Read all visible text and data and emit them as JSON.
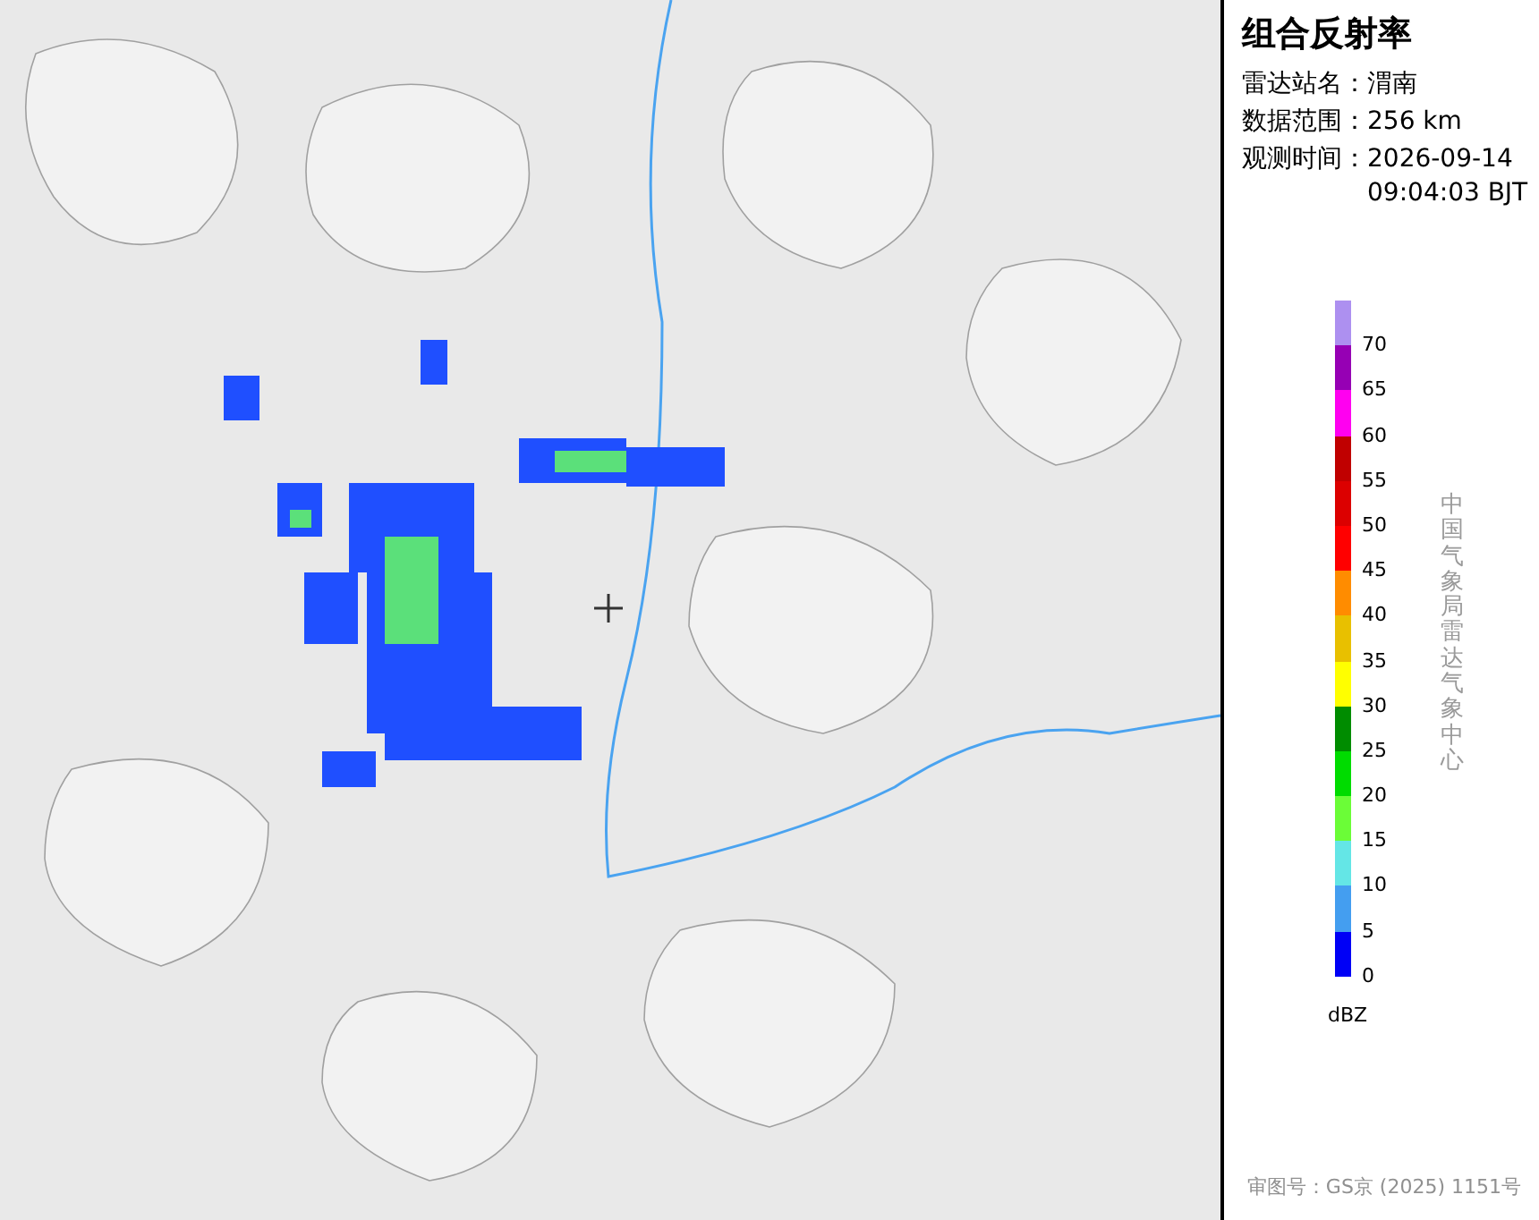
{
  "title": "组合反射率",
  "info": [
    {
      "label": "雷达站名：",
      "value": "渭南"
    },
    {
      "label": "数据范围：",
      "value": "256 km"
    },
    {
      "label": "观测时间：",
      "value": "2026-09-14 09:04:03 BJT"
    }
  ],
  "legend": {
    "items": [
      {
        "label": "70",
        "color": "#ad90f0"
      },
      {
        "label": "65",
        "color": "#9600b4"
      },
      {
        "label": "60",
        "color": "#ff00f0"
      },
      {
        "label": "55",
        "color": "#c00000"
      },
      {
        "label": "50",
        "color": "#dc0000"
      },
      {
        "label": "45",
        "color": "#ff0000"
      },
      {
        "label": "40",
        "color": "#ff8c00"
      },
      {
        "label": "35",
        "color": "#e8c000"
      },
      {
        "label": "30",
        "color": "#ffff00"
      },
      {
        "label": "25",
        "color": "#008c00"
      },
      {
        "label": "20",
        "color": "#00dc00"
      },
      {
        "label": "15",
        "color": "#6bfd37"
      },
      {
        "label": "10",
        "color": "#64e6e6"
      },
      {
        "label": "5",
        "color": "#449ef0"
      },
      {
        "label": "0",
        "color": "#0000f6"
      }
    ],
    "unit": "dBZ"
  },
  "credit": "中国气象局雷达气象中心",
  "approval": "审图号：GS京 (2025) 1151号"
}
